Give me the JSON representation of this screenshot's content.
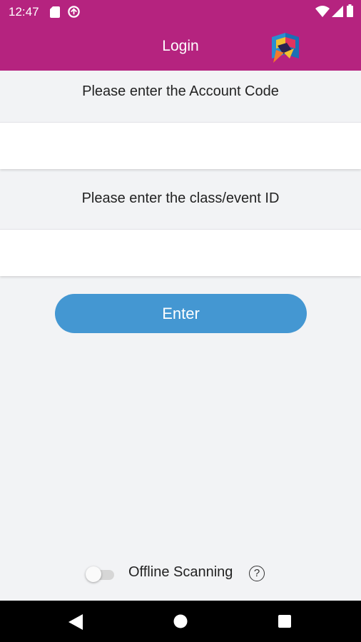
{
  "status_bar": {
    "time": "12:47"
  },
  "app_bar": {
    "title": "Login"
  },
  "form": {
    "account_code_prompt": "Please enter the Account Code",
    "account_code_value": "",
    "class_event_prompt": "Please enter the class/event ID",
    "class_event_value": "",
    "enter_label": "Enter"
  },
  "offline": {
    "label": "Offline Scanning",
    "help_symbol": "?",
    "enabled": false
  },
  "colors": {
    "app_bar": "#b5237f",
    "button": "#4497d2",
    "background": "#f2f3f5"
  },
  "icons": {
    "status_left": [
      "sd-card-icon",
      "data-saver-icon"
    ],
    "status_right": [
      "wifi-icon",
      "cell-signal-icon",
      "battery-icon"
    ],
    "nav": [
      "back-icon",
      "home-icon",
      "recents-icon"
    ]
  }
}
